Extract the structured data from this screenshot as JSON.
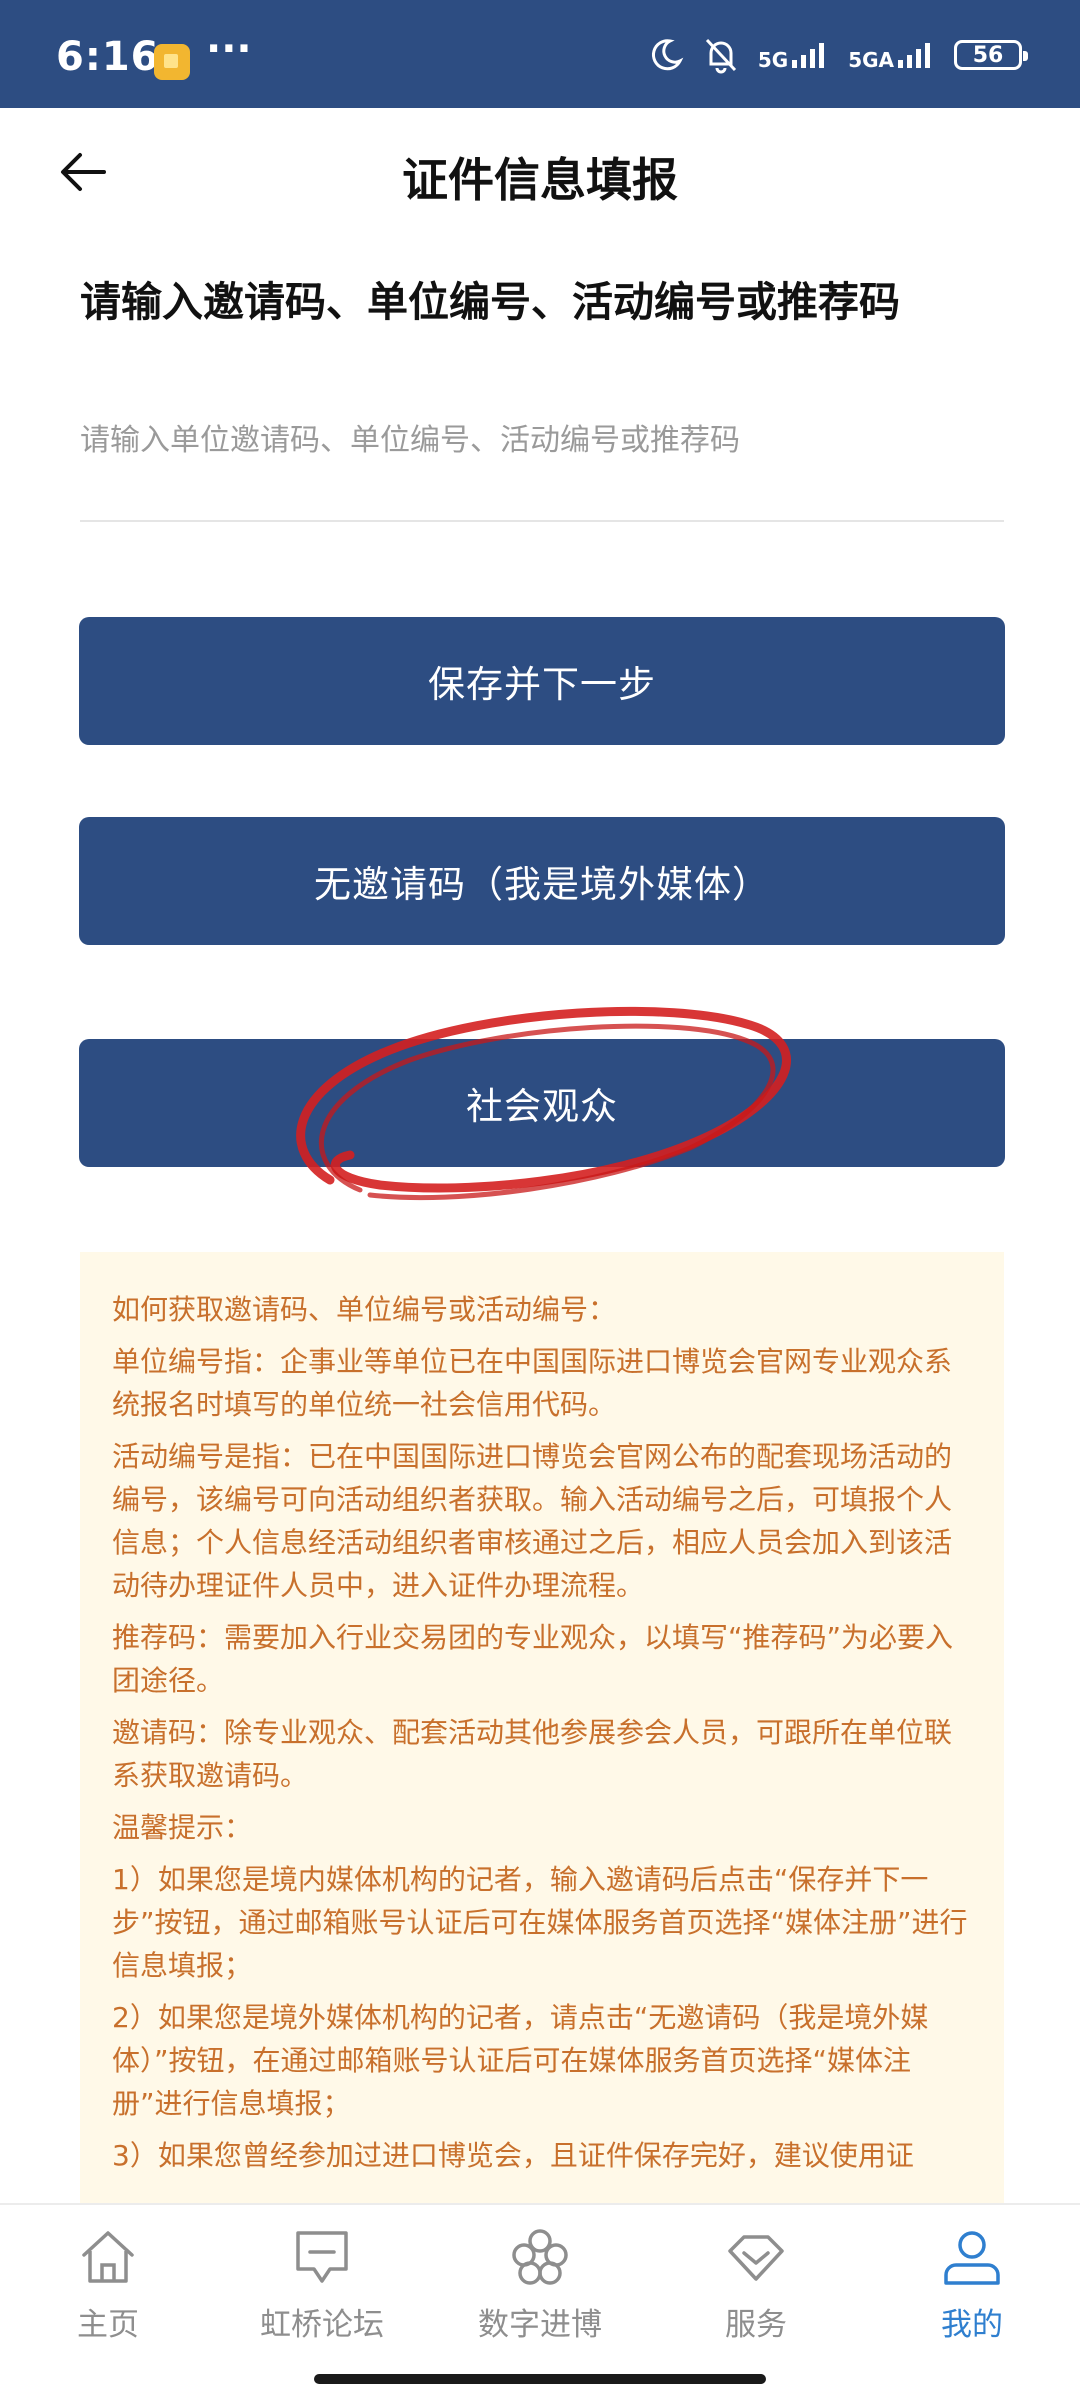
{
  "status_bar": {
    "time": "6:16",
    "dots": "···",
    "net1": "5G",
    "net2": "5GA",
    "battery": "56"
  },
  "header": {
    "title": "证件信息填报"
  },
  "form": {
    "label": "请输入邀请码、单位编号、活动编号或推荐码",
    "input_placeholder": "请输入单位邀请码、单位编号、活动编号或推荐码",
    "input_value": ""
  },
  "buttons": {
    "save_next": "保存并下一步",
    "no_invite": "无邀请码（我是境外媒体）",
    "public": "社会观众"
  },
  "info": {
    "paragraphs": [
      "如何获取邀请码、单位编号或活动编号：",
      "单位编号指：企事业等单位已在中国国际进口博览会官网专业观众系统报名时填写的单位统一社会信用代码。",
      "活动编号是指：已在中国国际进口博览会官网公布的配套现场活动的编号，该编号可向活动组织者获取。输入活动编号之后，可填报个人信息；个人信息经活动组织者审核通过之后，相应人员会加入到该活动待办理证件人员中，进入证件办理流程。",
      "推荐码：需要加入行业交易团的专业观众，以填写“推荐码”为必要入团途径。",
      "邀请码：除专业观众、配套活动其他参展参会人员，可跟所在单位联系获取邀请码。",
      "温馨提示：",
      "1）如果您是境内媒体机构的记者，输入邀请码后点击“保存并下一步”按钮，通过邮箱账号认证后可在媒体服务首页选择“媒体注册”进行信息填报；",
      "2）如果您是境外媒体机构的记者，请点击“无邀请码（我是境外媒体）”按钮，在通过邮箱账号认证后可在媒体服务首页选择“媒体注册”进行信息填报；",
      "3）如果您曾经参加过进口博览会，且证件保存完好，建议使用证"
    ]
  },
  "tabbar": {
    "items": [
      {
        "label": "主页",
        "icon": "home-icon"
      },
      {
        "label": "虹桥论坛",
        "icon": "forum-icon"
      },
      {
        "label": "数字进博",
        "icon": "digital-icon"
      },
      {
        "label": "服务",
        "icon": "service-icon"
      },
      {
        "label": "我的",
        "icon": "user-icon",
        "active": true
      }
    ]
  },
  "colors": {
    "brand": "#2d4d82",
    "info_bg": "#fff9e8",
    "info_text": "#c8702c",
    "tab_active": "#2f7fcf",
    "annotation": "#d42020"
  }
}
